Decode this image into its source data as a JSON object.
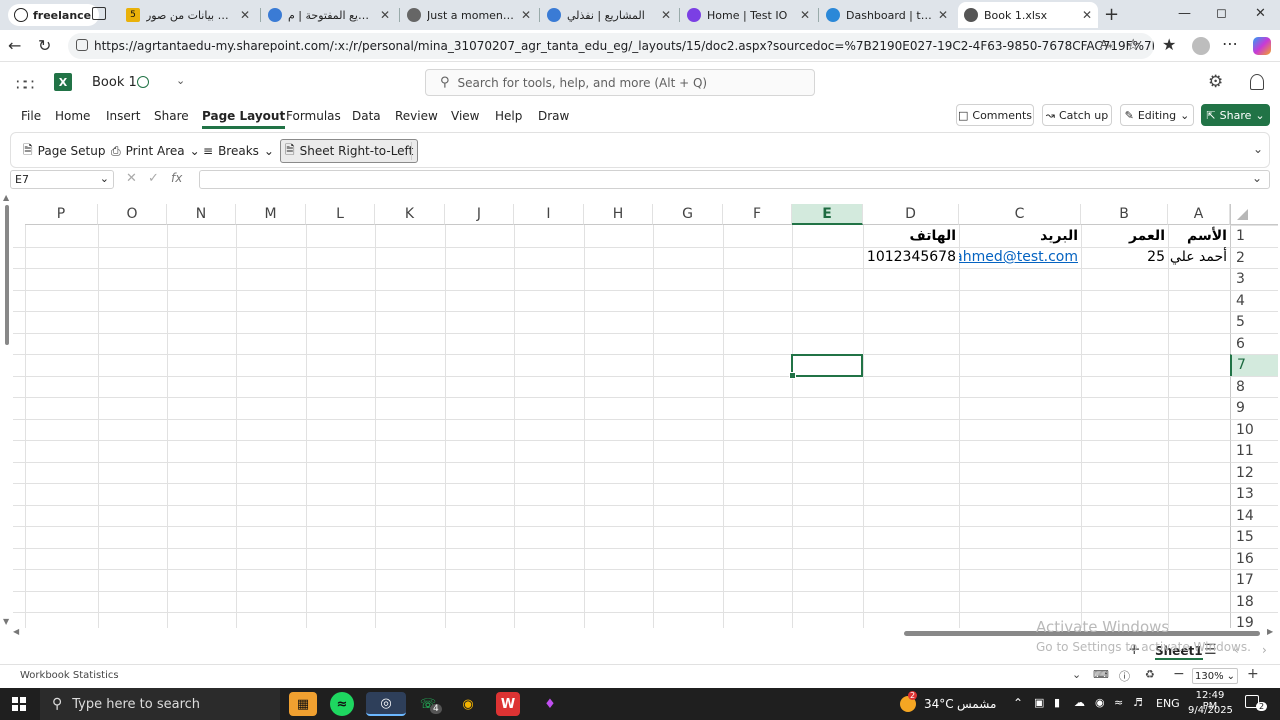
{
  "browser": {
    "freelance_label": "freelance",
    "tabs": [
      {
        "title": "تفريغ بيانات من صور",
        "icon_color": "#e9b10a",
        "badge": "5"
      },
      {
        "title": "المشاريع المفتوحة | م",
        "icon_color": "#3a7bd5"
      },
      {
        "title": "Just a moment...",
        "icon_color": "#666666"
      },
      {
        "title": "المشاريع | نفذلي",
        "icon_color": "#3a7bd5"
      },
      {
        "title": "Home | Test IO",
        "icon_color": "#7b3fe4"
      },
      {
        "title": "Dashboard | test IO",
        "icon_color": "#2b88d8"
      },
      {
        "title": "Book 1.xlsx",
        "icon_color": "#555555"
      }
    ],
    "url": "https://agrtantaedu-my.sharepoint.com/:x:/r/personal/mina_31070207_agr_tanta_edu_eg/_layouts/15/doc2.aspx?sourcedoc=%7B2190E027-19C2-4F63-9850-7678CFAC719F%7D&file=Book%2..."
  },
  "app": {
    "doc_title": "Book 1",
    "search_placeholder": "Search for tools, help, and more (Alt + Q)",
    "brand_color": "#217346"
  },
  "menu": {
    "items": [
      "File",
      "Home",
      "Insert",
      "Share",
      "Page Layout",
      "Formulas",
      "Data",
      "Review",
      "View",
      "Help",
      "Draw"
    ],
    "active": "Page Layout",
    "comments": "Comments",
    "catchup": "Catch up",
    "editing": "Editing",
    "share": "Share"
  },
  "ribbon": {
    "page_setup": "Page Setup",
    "print_area": "Print Area",
    "breaks": "Breaks",
    "sheet_rtl": "Sheet Right-to-Left"
  },
  "formula": {
    "name_box": "E7",
    "fx": "fx",
    "value": ""
  },
  "grid": {
    "columns": [
      "A",
      "B",
      "C",
      "D",
      "E",
      "F",
      "G",
      "H",
      "I",
      "J",
      "K",
      "L",
      "M",
      "N",
      "O",
      "P"
    ],
    "rows": [
      "1",
      "2",
      "3",
      "4",
      "5",
      "6",
      "7",
      "8",
      "9",
      "10",
      "11",
      "12",
      "13",
      "14",
      "15",
      "16",
      "17",
      "18",
      "19"
    ],
    "selected_col": "E",
    "selected_row": "7",
    "cells": {
      "A1": "الأسم",
      "B1": "العمر",
      "C1": "البريد",
      "D1": "الهاتف",
      "A2": "أحمد علي",
      "B2": "25",
      "C2": "ahmed@test.com",
      "D2": "1012345678"
    }
  },
  "sheets": {
    "tabs": [
      "Sheet1"
    ],
    "active": "Sheet1"
  },
  "status": {
    "workbook_stats": "Workbook Statistics",
    "zoom": "130%"
  },
  "watermark": {
    "line1": "Activate Windows",
    "line2": "Go to Settings to activate Windows."
  },
  "taskbar": {
    "search_placeholder": "Type here to search",
    "weather_temp": "34°C",
    "weather_text": "مشمس",
    "weather_badge": "2",
    "whatsapp_badge": "4",
    "lang": "ENG",
    "time": "12:49 PM",
    "date": "9/4/2025",
    "notif_count": "2"
  }
}
